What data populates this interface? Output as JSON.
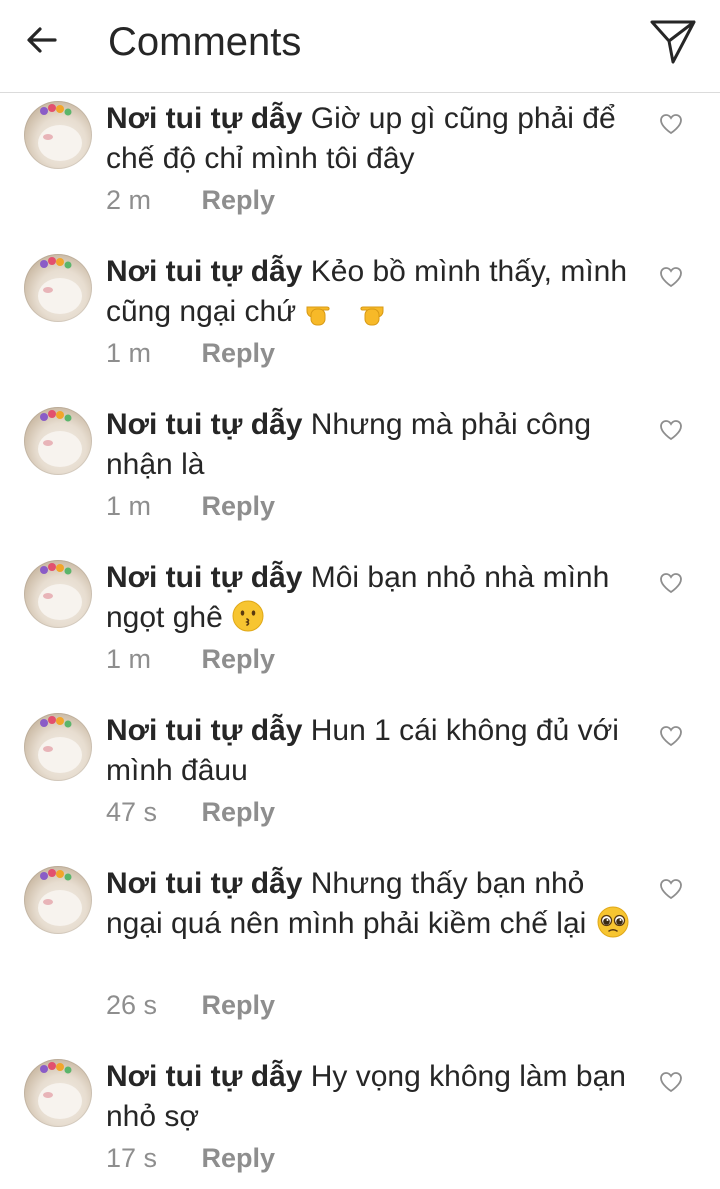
{
  "header": {
    "title": "Comments",
    "back_icon": "arrow-left-icon",
    "send_icon": "paper-plane-icon"
  },
  "colors": {
    "text": "#262626",
    "secondary": "#8e8e8e",
    "divider": "#dbdbdb"
  },
  "comments": [
    {
      "username": "Nơi tui tự dẫy",
      "text": "Giờ up gì cũng phải để chế độ chỉ mình tôi đây",
      "time": "2 m",
      "reply": "Reply",
      "emoji": ""
    },
    {
      "username": "Nơi tui tự dẫy",
      "text": "Kẻo bồ mình thấy, mình cũng ngại chứ",
      "time": "1 m",
      "reply": "Reply",
      "emoji": "pointing-hands-emoji"
    },
    {
      "username": "Nơi tui tự dẫy",
      "text": "Nhưng mà phải công nhận là",
      "time": "1 m",
      "reply": "Reply",
      "emoji": ""
    },
    {
      "username": "Nơi tui tự dẫy",
      "text": "Môi bạn nhỏ nhà mình ngọt ghê",
      "time": "1 m",
      "reply": "Reply",
      "emoji": "kissing-face-emoji"
    },
    {
      "username": "Nơi tui tự dẫy",
      "text": "Hun 1 cái không đủ với mình đâuu",
      "time": "47 s",
      "reply": "Reply",
      "emoji": ""
    },
    {
      "username": "Nơi tui tự dẫy",
      "text": "Nhưng thấy bạn nhỏ ngại quá nên mình phải kiềm chế lại",
      "time": "26 s",
      "reply": "Reply",
      "emoji": "pleading-face-emoji"
    },
    {
      "username": "Nơi tui tự dẫy",
      "text": "Hy vọng không làm bạn nhỏ sợ",
      "time": "17 s",
      "reply": "Reply",
      "emoji": ""
    }
  ]
}
